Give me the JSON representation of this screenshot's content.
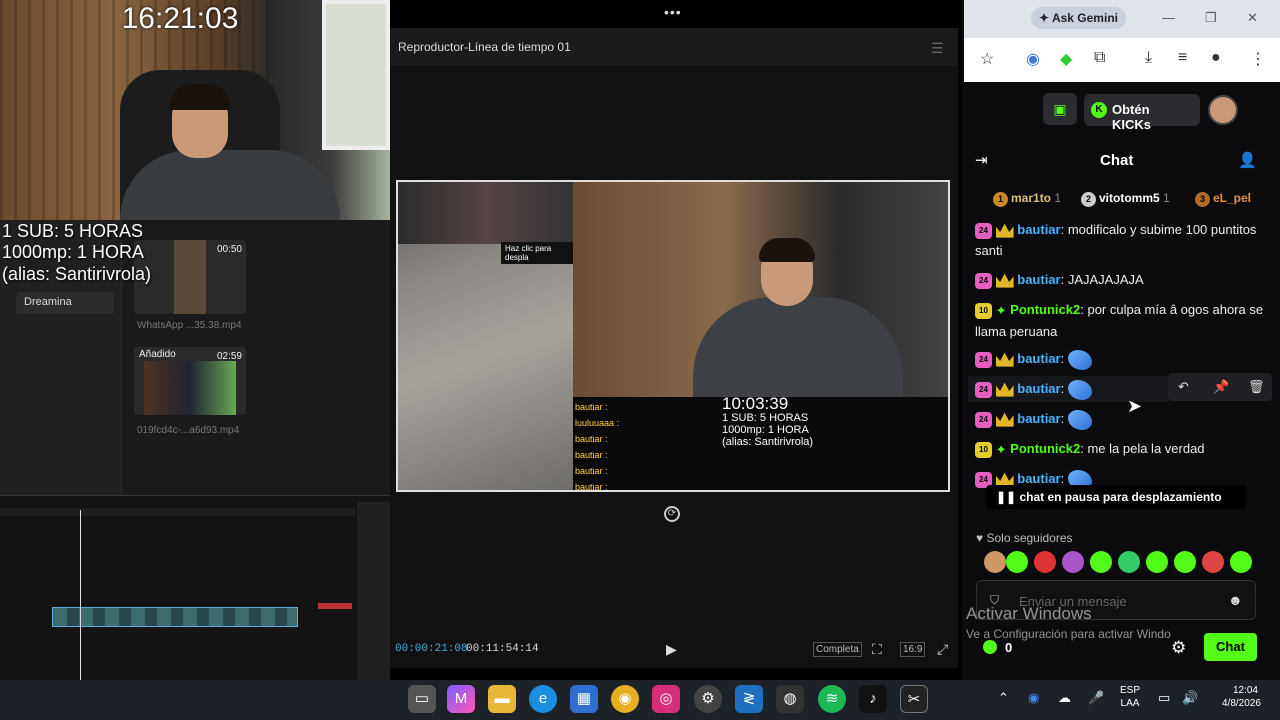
{
  "webcam": {
    "clock": "16:21:03",
    "overlay_lines": [
      "1 SUB: 5 HORAS",
      "1000mp: 1 HORA",
      "(alias: Santirivrola)"
    ]
  },
  "editor": {
    "sidebar_item": "Dreamina",
    "media": [
      {
        "name": "WhatsApp ...35.38.mp4",
        "duration": "00:50"
      },
      {
        "name": "019fcd4c-...a6d93.mp4",
        "duration": "02:59",
        "badge": "Añadido"
      }
    ]
  },
  "preview": {
    "title": "Reproductor-Línea de tiempo 01",
    "current_time": "00:00:21:08",
    "total_time": "00:11:54:14",
    "mode_label": "Completa",
    "ratio_label": "16:9",
    "video_overlay": {
      "phone_hint": "Haz clic para despla",
      "clock": "10:03:39",
      "lines": [
        "1 SUB: 5 HORAS",
        "1000mp: 1 HORA",
        "(alias: Santirivrola)"
      ],
      "mini_chat": [
        "bautiar :",
        "luuluuaaa :",
        "bautiar :",
        "bautiar :",
        "bautiar :",
        "bautiar :"
      ]
    }
  },
  "browser": {
    "gemini_label": "Ask Gemini",
    "obten_label": "Obtén KICKs",
    "chat_title": "Chat",
    "leaderboard": [
      {
        "rank": "1",
        "name": "mar1to",
        "count": "1"
      },
      {
        "rank": "2",
        "name": "vitotomm5",
        "count": "1"
      },
      {
        "rank": "3",
        "name": "eL_pel",
        "count": ""
      }
    ],
    "messages": [
      {
        "badge": "24",
        "user": "bautiar",
        "text": "modificalo y subime 100 puntitos santi"
      },
      {
        "badge": "24",
        "user": "bautiar",
        "text": "JAJAJAJAJA"
      },
      {
        "badge": "10",
        "user": "Pontunick2",
        "text": "por culpa mía â ogos ahora se llama peruana"
      },
      {
        "badge": "24",
        "user": "bautiar",
        "text": ""
      },
      {
        "badge": "24",
        "user": "bautiar",
        "text": ""
      },
      {
        "badge": "24",
        "user": "bautiar",
        "text": ""
      },
      {
        "badge": "10",
        "user": "Pontunick2",
        "text": "me la pela la verdad"
      },
      {
        "badge": "24",
        "user": "bautiar",
        "text": ""
      }
    ],
    "paused_label": "chat en pausa para desplazamiento",
    "followers_only": "Solo seguidores",
    "input_placeholder": "Enviar un mensaje",
    "points": "0",
    "chat_button": "Chat",
    "watermark_title": "Activar Windows",
    "watermark_sub": "Ve a Configuración para activar Windo"
  },
  "taskbar": {
    "lang": "ESP",
    "lang2": "LAA",
    "time": "12:04",
    "date": "4/8/2026"
  },
  "colors": {
    "kick_green": "#53fc18",
    "username_blue": "#4ab3ff",
    "sub_badge": "#e65fbf"
  }
}
